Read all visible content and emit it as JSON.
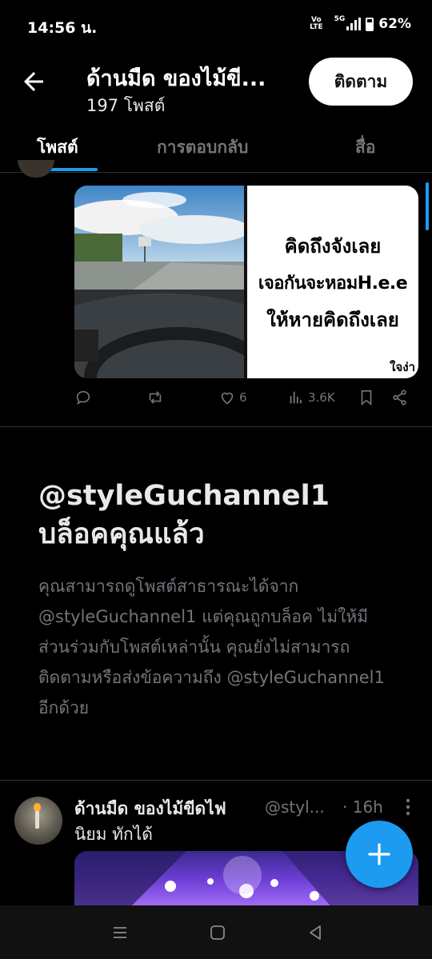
{
  "status_bar": {
    "time": "14:56 น.",
    "volte_top": "Vo",
    "volte_bottom": "LTE",
    "network": "5G",
    "battery": "62%"
  },
  "header": {
    "title": "ด้านมืด ของไม้ขี...",
    "post_count": "197 โพสต์",
    "follow_label": "ติดตาม"
  },
  "tabs": [
    {
      "label": "โพสต์",
      "active": true
    },
    {
      "label": "การตอบกลับ",
      "active": false
    },
    {
      "label": "สื่อ",
      "active": false
    }
  ],
  "post1": {
    "image_text": {
      "line1": "คิดถึงจังเลย",
      "line2": "เจอกันจะหอมH.e.e",
      "line3": "ให้หายคิดถึงเลย",
      "brand": "ใจง่า"
    },
    "actions": {
      "likes": "6",
      "views": "3.6K"
    }
  },
  "blocked": {
    "title_line1": "@styleGuchannel1",
    "title_line2": "บล็อคคุณแล้ว",
    "body": "คุณสามารถดูโพสต์สาธารณะได้จาก @styleGuchannel1 แต่คุณถูกบล็อค ไม่ให้มีส่วนร่วมกับโพสต์เหล่านั้น คุณยังไม่สามารถติดตามหรือส่งข้อความถึง @styleGuchannel1 อีกด้วย"
  },
  "post2": {
    "name": "ด้านมืด ของไม้ขีดไฟ",
    "handle": "@styl...",
    "time": "· 16h",
    "text": "นิยม ทักได้"
  },
  "colors": {
    "accent": "#1d9bf0",
    "background": "#000000",
    "muted": "#71767b"
  }
}
